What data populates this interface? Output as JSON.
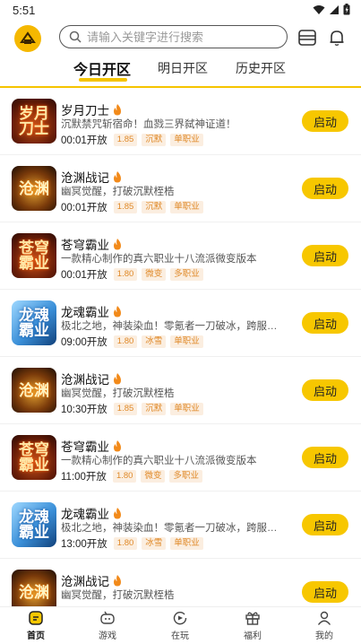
{
  "status_bar": {
    "time": "5:51"
  },
  "search": {
    "placeholder": "请输入关键字进行搜索"
  },
  "tabs": [
    {
      "label": "今日开区",
      "active": true
    },
    {
      "label": "明日开区",
      "active": false
    },
    {
      "label": "历史开区",
      "active": false
    }
  ],
  "games": [
    {
      "title": "岁月刀士",
      "icon": "suiyue",
      "desc": "沉默禁咒斩宿命！血戮三界弑神证道！",
      "time": "00:01开放",
      "tags": [
        "1.85",
        "沉默",
        "单职业"
      ],
      "button": "启动"
    },
    {
      "title": "沧渊战记",
      "icon": "cangyuan",
      "desc": "幽冥觉醒，打破沉默桎梏",
      "time": "00:01开放",
      "tags": [
        "1.85",
        "沉默",
        "单职业"
      ],
      "button": "启动"
    },
    {
      "title": "苍穹霸业",
      "icon": "cangqiong",
      "desc": "一款精心制作的真六职业十八流派微变版本",
      "time": "00:01开放",
      "tags": [
        "1.80",
        "微变",
        "多职业"
      ],
      "button": "启动"
    },
    {
      "title": "龙魂霸业",
      "icon": "longhun",
      "desc": "极北之地，神装染血！零氪者一刀破冰，跨服战改…",
      "time": "09:00开放",
      "tags": [
        "1.80",
        "冰雪",
        "单职业"
      ],
      "button": "启动"
    },
    {
      "title": "沧渊战记",
      "icon": "cangyuan",
      "desc": "幽冥觉醒，打破沉默桎梏",
      "time": "10:30开放",
      "tags": [
        "1.85",
        "沉默",
        "单职业"
      ],
      "button": "启动"
    },
    {
      "title": "苍穹霸业",
      "icon": "cangqiong",
      "desc": "一款精心制作的真六职业十八流派微变版本",
      "time": "11:00开放",
      "tags": [
        "1.80",
        "微变",
        "多职业"
      ],
      "button": "启动"
    },
    {
      "title": "龙魂霸业",
      "icon": "longhun",
      "desc": "极北之地，神装染血！零氪者一刀破冰，跨服战改…",
      "time": "13:00开放",
      "tags": [
        "1.80",
        "冰雪",
        "单职业"
      ],
      "button": "启动"
    },
    {
      "title": "沧渊战记",
      "icon": "cangyuan",
      "desc": "幽冥觉醒，打破沉默桎梏",
      "time": "",
      "tags": [],
      "button": "启动"
    }
  ],
  "bottom_nav": [
    {
      "label": "首页",
      "icon": "home-icon",
      "active": true
    },
    {
      "label": "游戏",
      "icon": "gamepad-icon",
      "active": false
    },
    {
      "label": "在玩",
      "icon": "playing-icon",
      "active": false
    },
    {
      "label": "福利",
      "icon": "gift-icon",
      "active": false
    },
    {
      "label": "我的",
      "icon": "user-icon",
      "active": false
    }
  ],
  "colors": {
    "accent": "#f7c700",
    "tag_text": "#e08a2a",
    "tag_bg": "#fbeee0"
  }
}
